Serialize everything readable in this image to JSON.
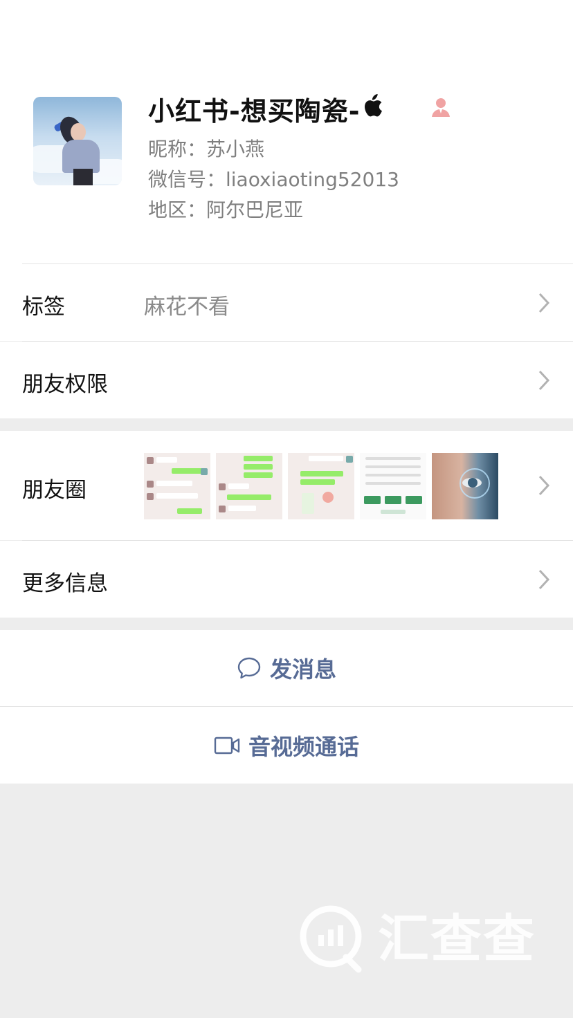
{
  "profile": {
    "name": "小红书-想买陶瓷-",
    "apple_glyph": "",
    "nickname": "昵称：苏小燕",
    "wechat_id": "微信号：liaoxiaoting52013",
    "region": "地区：阿尔巴尼亚",
    "gender_icon": "female-icon",
    "gender_color": "#fa5151"
  },
  "rows": {
    "tags": {
      "label": "标签",
      "value": "麻花不看"
    },
    "friend_permissions": {
      "label": "朋友权限"
    },
    "moments": {
      "label": "朋友圈"
    },
    "more_info": {
      "label": "更多信息"
    }
  },
  "actions": {
    "send_message": {
      "label": "发消息",
      "icon": "chat-bubble-icon"
    },
    "video_call": {
      "label": "音视频通话",
      "icon": "video-camera-icon"
    }
  },
  "colors": {
    "link": "#576b95",
    "background": "#ededed",
    "wechat_green": "#95ec69"
  },
  "watermark": {
    "text": "汇查查"
  }
}
